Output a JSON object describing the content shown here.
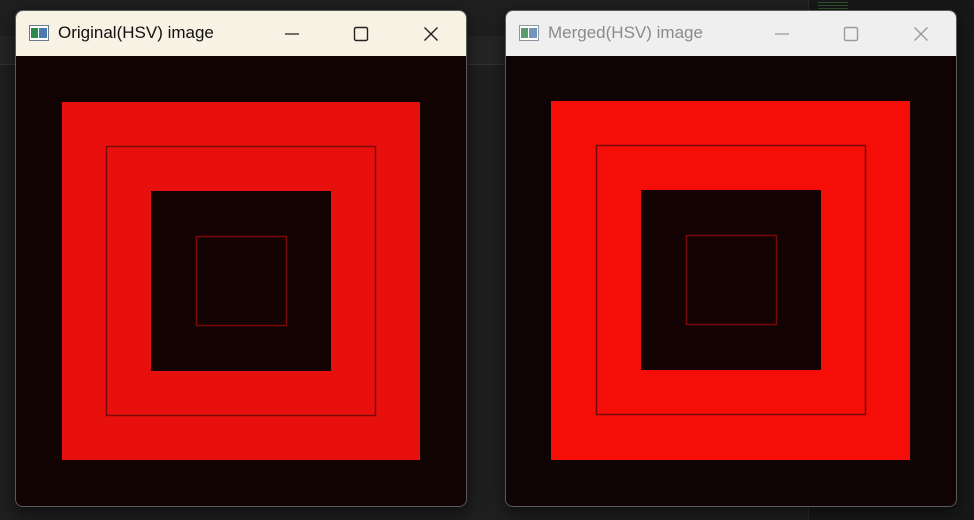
{
  "windows": [
    {
      "title": "Original(HSV) image",
      "state": "active",
      "controls": {
        "minimize": "minimize-icon",
        "maximize": "maximize-icon",
        "close": "close-icon"
      },
      "image": {
        "background": "#120303",
        "outer_square": "#e8100c",
        "outline": "#7a0a0a",
        "inner_dark": "#130303"
      }
    },
    {
      "title": "Merged(HSV) image",
      "state": "inactive",
      "controls": {
        "minimize": "minimize-icon",
        "maximize": "maximize-icon",
        "close": "close-icon"
      },
      "image": {
        "background": "#100303",
        "outer_square": "#f50d08",
        "outline": "#7a0a0a",
        "inner_dark": "#130303"
      }
    }
  ]
}
